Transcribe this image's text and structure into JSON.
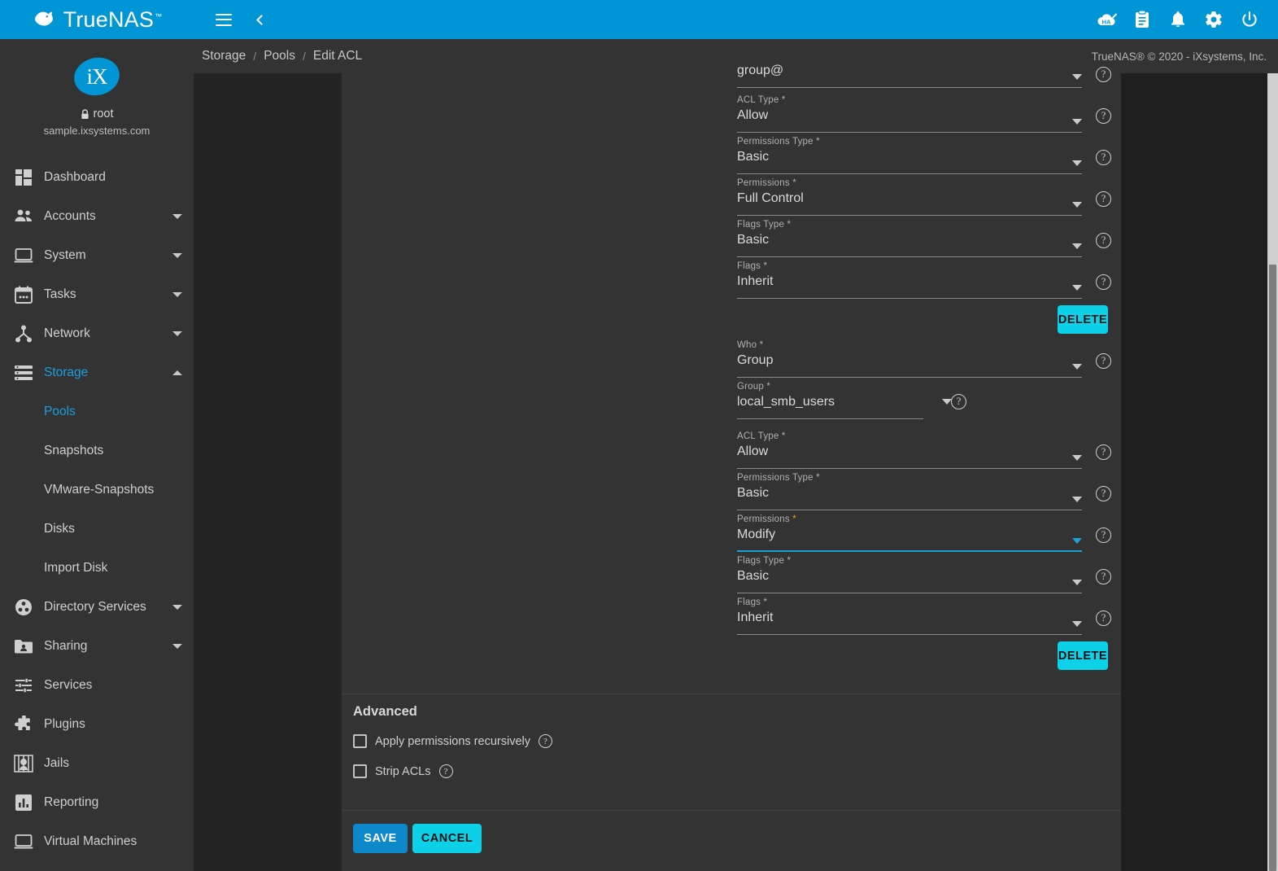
{
  "topbar": {
    "brand": "TrueNAS",
    "brand_tm": "™",
    "bg_color": "#0095d5",
    "menu_icon": "hamburger-icon",
    "back_icon": "chevron-left-icon",
    "icons": [
      {
        "name": "ha-cloud-icon",
        "title": "HA"
      },
      {
        "name": "clipboard-icon",
        "title": "Tasks"
      },
      {
        "name": "bell-icon",
        "title": "Alerts"
      },
      {
        "name": "gear-icon",
        "title": "Settings"
      },
      {
        "name": "power-icon",
        "title": "Power"
      }
    ]
  },
  "breadcrumb": {
    "items": [
      "Storage",
      "Pools",
      "Edit ACL"
    ],
    "separator": "/",
    "copyright": "TrueNAS® © 2020 - iXsystems, Inc."
  },
  "sidebar": {
    "logo_text": "iX",
    "user": "root",
    "host": "sample.ixsystems.com",
    "items": [
      {
        "label": "Dashboard",
        "icon": "dashboard-icon",
        "caret": null,
        "active": false
      },
      {
        "label": "Accounts",
        "icon": "accounts-icon",
        "caret": "down",
        "active": false
      },
      {
        "label": "System",
        "icon": "system-icon",
        "caret": "down",
        "active": false
      },
      {
        "label": "Tasks",
        "icon": "tasks-icon",
        "caret": "down",
        "active": false
      },
      {
        "label": "Network",
        "icon": "network-icon",
        "caret": "down",
        "active": false
      },
      {
        "label": "Storage",
        "icon": "storage-icon",
        "caret": "up",
        "active": true
      }
    ],
    "storage_children": [
      {
        "label": "Pools",
        "active": true
      },
      {
        "label": "Snapshots",
        "active": false
      },
      {
        "label": "VMware-Snapshots",
        "active": false
      },
      {
        "label": "Disks",
        "active": false
      },
      {
        "label": "Import Disk",
        "active": false
      }
    ],
    "items_after": [
      {
        "label": "Directory Services",
        "icon": "directory-services-icon",
        "caret": "down",
        "active": false
      },
      {
        "label": "Sharing",
        "icon": "sharing-icon",
        "caret": "down",
        "active": false
      },
      {
        "label": "Services",
        "icon": "services-icon",
        "caret": null,
        "active": false
      },
      {
        "label": "Plugins",
        "icon": "plugins-icon",
        "caret": null,
        "active": false
      },
      {
        "label": "Jails",
        "icon": "jails-icon",
        "caret": null,
        "active": false
      },
      {
        "label": "Reporting",
        "icon": "reporting-icon",
        "caret": null,
        "active": false
      },
      {
        "label": "Virtual Machines",
        "icon": "virtual-machines-icon",
        "caret": null,
        "active": false
      }
    ]
  },
  "form": {
    "entry1": {
      "who_value": "group@",
      "fields": [
        {
          "label": "ACL Type",
          "required": "*",
          "value": "Allow"
        },
        {
          "label": "Permissions Type",
          "required": "*",
          "value": "Basic"
        },
        {
          "label": "Permissions",
          "required": "*",
          "value": "Full Control"
        },
        {
          "label": "Flags Type",
          "required": "*",
          "value": "Basic"
        },
        {
          "label": "Flags",
          "required": "*",
          "value": "Inherit"
        }
      ],
      "delete_label": "DELETE"
    },
    "entry2": {
      "who": {
        "label": "Who",
        "required": "*",
        "value": "Group"
      },
      "group": {
        "label": "Group",
        "required": "*",
        "value": "local_smb_users"
      },
      "fields": [
        {
          "label": "ACL Type",
          "required": "*",
          "value": "Allow",
          "focused": false
        },
        {
          "label": "Permissions Type",
          "required": "*",
          "value": "Basic",
          "focused": false
        },
        {
          "label": "Permissions",
          "required": "*",
          "value": "Modify",
          "focused": true
        },
        {
          "label": "Flags Type",
          "required": "*",
          "value": "Basic",
          "focused": false
        },
        {
          "label": "Flags",
          "required": "*",
          "value": "Inherit",
          "focused": false
        }
      ],
      "delete_label": "DELETE"
    },
    "advanced": {
      "title": "Advanced",
      "checkboxes": [
        {
          "label": "Apply permissions recursively",
          "checked": false
        },
        {
          "label": "Strip ACLs",
          "checked": false
        }
      ]
    },
    "actions": {
      "save_label": "SAVE",
      "cancel_label": "CANCEL"
    }
  },
  "colors": {
    "accent_blue": "#0095d5",
    "cyan": "#0cd1e8",
    "save_blue": "#0d88ca",
    "focus_blue": "#1f9fd8",
    "required_amber": "#f0a500",
    "sidebar_bg": "#333333",
    "card_bg": "#333333",
    "page_bg": "#1f1f1f"
  },
  "help_glyph": "?"
}
